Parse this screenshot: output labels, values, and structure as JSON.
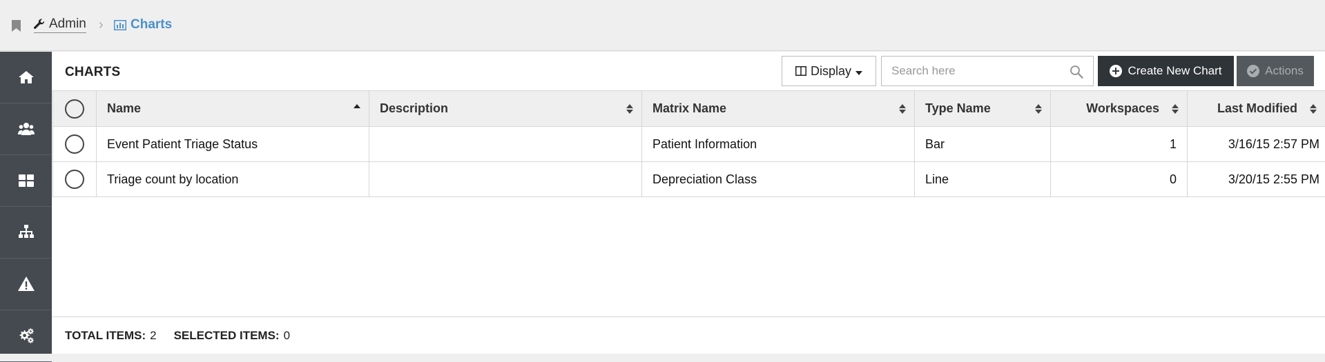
{
  "breadcrumb": {
    "admin_label": "Admin",
    "separator": "›",
    "charts_label": "Charts"
  },
  "sidebar": {
    "items": [
      {
        "icon": "home-icon"
      },
      {
        "icon": "users-icon"
      },
      {
        "icon": "dashboard-icon"
      },
      {
        "icon": "hierarchy-icon"
      },
      {
        "icon": "warning-icon"
      },
      {
        "icon": "gears-icon"
      }
    ]
  },
  "panel": {
    "title": "CHARTS"
  },
  "toolbar": {
    "display_label": "Display",
    "search_placeholder": "Search here",
    "create_label": "Create New Chart",
    "actions_label": "Actions"
  },
  "table": {
    "columns": [
      "Name",
      "Description",
      "Matrix Name",
      "Type Name",
      "Workspaces",
      "Last Modified"
    ],
    "rows": [
      {
        "name": "Event Patient Triage Status",
        "description": "",
        "matrix": "Patient Information",
        "type": "Bar",
        "workspaces": "1",
        "modified": "3/16/15 2:57 PM"
      },
      {
        "name": "Triage count by location",
        "description": "",
        "matrix": "Depreciation Class",
        "type": "Line",
        "workspaces": "0",
        "modified": "3/20/15 2:55 PM"
      }
    ]
  },
  "footer": {
    "total_label": "TOTAL ITEMS:",
    "total_value": "2",
    "selected_label": "SELECTED ITEMS:",
    "selected_value": "0"
  },
  "colors": {
    "accent": "#4a90c9",
    "sidebar": "#454a51",
    "primary_button": "#2f3438"
  }
}
